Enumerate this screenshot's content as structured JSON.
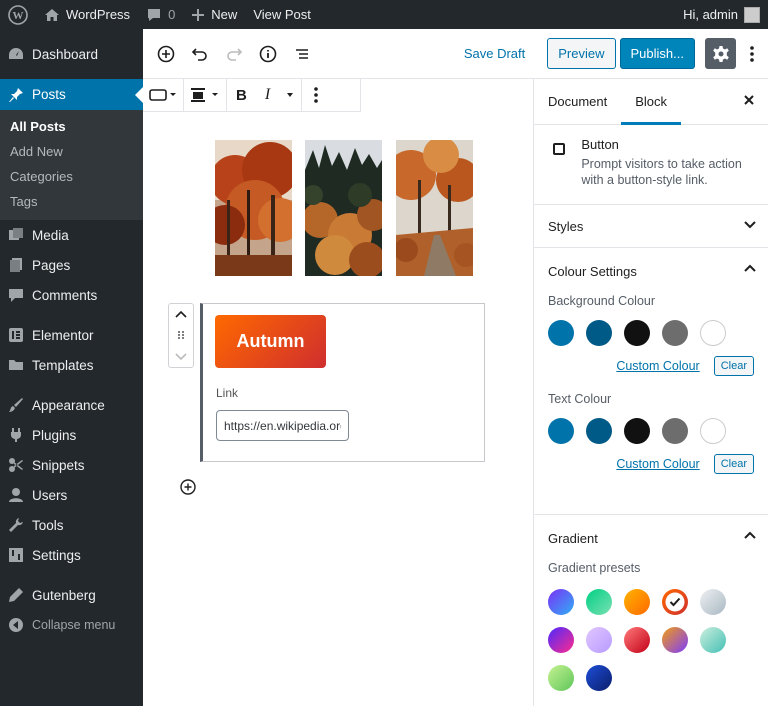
{
  "adminbar": {
    "site": "WordPress",
    "comments": "0",
    "new": "New",
    "view": "View Post",
    "greeting": "Hi, admin"
  },
  "sidebar": {
    "items": [
      {
        "label": "Dashboard",
        "icon": "dashboard-icon"
      },
      {
        "label": "Posts",
        "icon": "pin-icon",
        "active": true
      },
      {
        "label": "Media",
        "icon": "media-icon"
      },
      {
        "label": "Pages",
        "icon": "pages-icon"
      },
      {
        "label": "Comments",
        "icon": "comments-icon"
      },
      {
        "label": "Elementor",
        "icon": "elementor-icon"
      },
      {
        "label": "Templates",
        "icon": "folder-icon"
      },
      {
        "label": "Appearance",
        "icon": "brush-icon"
      },
      {
        "label": "Plugins",
        "icon": "plug-icon"
      },
      {
        "label": "Snippets",
        "icon": "scissors-icon"
      },
      {
        "label": "Users",
        "icon": "user-icon"
      },
      {
        "label": "Tools",
        "icon": "wrench-icon"
      },
      {
        "label": "Settings",
        "icon": "sliders-icon"
      },
      {
        "label": "Gutenberg",
        "icon": "pen-icon"
      },
      {
        "label": "Collapse menu",
        "icon": "collapse-icon"
      }
    ],
    "submenu": [
      "All Posts",
      "Add New",
      "Categories",
      "Tags"
    ]
  },
  "topbar": {
    "save_draft": "Save Draft",
    "preview": "Preview",
    "publish": "Publish..."
  },
  "block": {
    "button_text": "Autumn",
    "link_label": "Link",
    "link_value": "https://en.wikipedia.org/wiki/Autumn"
  },
  "panel": {
    "tabs": [
      "Document",
      "Block"
    ],
    "card_title": "Button",
    "card_desc": "Prompt visitors to take action with a button-style link.",
    "styles": "Styles",
    "colour_settings": "Colour Settings",
    "background_colour": "Background Colour",
    "text_colour": "Text Colour",
    "custom_colour": "Custom Colour",
    "clear": "Clear",
    "gradient": "Gradient",
    "gradient_presets": "Gradient presets"
  },
  "colors": {
    "accent": "#0073aa",
    "swatches": [
      "#0073aa",
      "#005a87",
      "#111111",
      "#6d6d6d",
      "#ffffff"
    ],
    "gradients": [
      "linear-gradient(135deg,#7b2ff7,#2fb0f5)",
      "linear-gradient(135deg,#00d084,#7be0b3)",
      "linear-gradient(135deg,#ffb300,#ff6900)",
      "linear-gradient(135deg,#ff6900,#cf2e2e)",
      "linear-gradient(135deg,#eef0f2,#a9b8c3)",
      "linear-gradient(135deg,#4b2aff,#ff2a8c)",
      "linear-gradient(135deg,#e1c6ff,#b79bff)",
      "linear-gradient(135deg,#ff7a7a,#c20017)",
      "linear-gradient(135deg,#f39c12,#7d3cff)",
      "linear-gradient(135deg,#cdeedd,#43c0b5)",
      "linear-gradient(135deg,#c6f291,#5ec65a)",
      "linear-gradient(135deg,#1d4ed8,#0b1d6b)"
    ]
  }
}
